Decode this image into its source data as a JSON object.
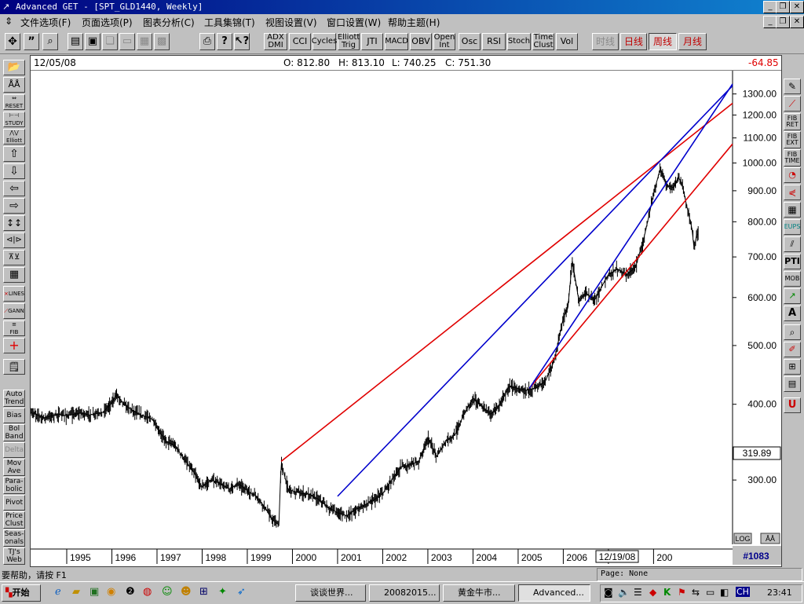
{
  "window": {
    "title": "Advanced GET - [SPT_GLD1440, Weekly]",
    "minimize": "_",
    "restore": "❐",
    "close": "✕"
  },
  "menu": [
    "文件选项(F)",
    "页面选项(P)",
    "图表分析(C)",
    "工具集锦(T)",
    "视图设置(V)",
    "窗口设置(W)",
    "帮助主题(H)"
  ],
  "toolbar": {
    "icons": [
      "cursor-icon",
      "quote-icon",
      "zoom-icon",
      "page-icon",
      "print-preview-icon",
      "copy-icon",
      "paste-icon",
      "edit-icon",
      "grid-icon",
      "printer-icon",
      "help-icon",
      "context-help-icon"
    ],
    "studies": [
      "ADX DMI",
      "CCI",
      "Cycles",
      "Elliott Trig",
      "JTI",
      "MACD",
      "OBV",
      "Open Int",
      "Osc",
      "RSI",
      "Stoch",
      "Time Clust",
      "Vol"
    ],
    "periods": [
      "时线",
      "日线",
      "周线",
      "月线"
    ],
    "active_period": "周线"
  },
  "quote": {
    "date": "12/05/08",
    "open": "O: 812.80",
    "high": "H: 813.10",
    "low": "L: 740.25",
    "close": "C: 751.30",
    "change": "-64.85"
  },
  "left_tools": [
    "Auto Trend",
    "Bias",
    "Bol Band",
    "Delta",
    "Mov Ave",
    "Para-bolic",
    "Pivot",
    "Price Clust",
    "Seas-onals",
    "TJ's Web"
  ],
  "right_tools": [
    "FIB RET",
    "FIB EXT",
    "FIB TIME",
    "EUPS",
    "PTI",
    "MOB",
    "A"
  ],
  "chart_data": {
    "type": "line",
    "scale": "log",
    "ylim": [
      235,
      1420
    ],
    "y_ticks": [
      "1300.00",
      "1200.00",
      "1100.00",
      "1000.00",
      "900.00",
      "800.00",
      "700.00",
      "600.00",
      "500.00",
      "400.00",
      "300.00"
    ],
    "y_tick_values": [
      1300,
      1200,
      1100,
      1000,
      900,
      800,
      700,
      600,
      500,
      400,
      300
    ],
    "x_labels": [
      "1995",
      "1996",
      "1997",
      "1998",
      "1999",
      "2000",
      "2001",
      "2002",
      "2003",
      "2004",
      "2005",
      "2006",
      "2007",
      "200"
    ],
    "x_label_values": [
      1995,
      1996,
      1997,
      1998,
      1999,
      2000,
      2001,
      2002,
      2003,
      2004,
      2005,
      2006,
      2007,
      2008
    ],
    "xlim": [
      1994.2,
      2009.75
    ],
    "current_price": "319.89",
    "date_marker": "12/19/08",
    "log_label": "LOG",
    "bar_count": "#1083",
    "series": [
      {
        "points": [
          [
            1994.2,
            388
          ],
          [
            1994.5,
            380
          ],
          [
            1994.8,
            385
          ],
          [
            1995.0,
            383
          ],
          [
            1995.3,
            387
          ],
          [
            1995.5,
            384
          ],
          [
            1995.8,
            388
          ],
          [
            1996.0,
            402
          ],
          [
            1996.1,
            415
          ],
          [
            1996.3,
            398
          ],
          [
            1996.6,
            385
          ],
          [
            1996.9,
            378
          ],
          [
            1997.0,
            365
          ],
          [
            1997.2,
            348
          ],
          [
            1997.4,
            342
          ],
          [
            1997.6,
            325
          ],
          [
            1997.8,
            310
          ],
          [
            1998.0,
            292
          ],
          [
            1998.2,
            300
          ],
          [
            1998.4,
            296
          ],
          [
            1998.6,
            290
          ],
          [
            1998.8,
            296
          ],
          [
            1999.0,
            288
          ],
          [
            1999.2,
            282
          ],
          [
            1999.4,
            270
          ],
          [
            1999.55,
            258
          ],
          [
            1999.7,
            253
          ],
          [
            1999.75,
            322
          ],
          [
            1999.8,
            310
          ],
          [
            1999.9,
            290
          ],
          [
            2000.0,
            288
          ],
          [
            2000.2,
            285
          ],
          [
            2000.4,
            284
          ],
          [
            2000.6,
            278
          ],
          [
            2000.8,
            270
          ],
          [
            2001.0,
            265
          ],
          [
            2001.2,
            262
          ],
          [
            2001.4,
            268
          ],
          [
            2001.6,
            273
          ],
          [
            2001.8,
            278
          ],
          [
            2002.0,
            285
          ],
          [
            2002.2,
            300
          ],
          [
            2002.4,
            315
          ],
          [
            2002.6,
            318
          ],
          [
            2002.8,
            322
          ],
          [
            2003.0,
            352
          ],
          [
            2003.2,
            328
          ],
          [
            2003.4,
            348
          ],
          [
            2003.6,
            356
          ],
          [
            2003.8,
            385
          ],
          [
            2004.0,
            410
          ],
          [
            2004.2,
            396
          ],
          [
            2004.4,
            385
          ],
          [
            2004.6,
            400
          ],
          [
            2004.8,
            428
          ],
          [
            2005.0,
            425
          ],
          [
            2005.2,
            422
          ],
          [
            2005.4,
            426
          ],
          [
            2005.6,
            436
          ],
          [
            2005.8,
            472
          ],
          [
            2006.0,
            555
          ],
          [
            2006.1,
            575
          ],
          [
            2006.2,
            690
          ],
          [
            2006.35,
            590
          ],
          [
            2006.5,
            610
          ],
          [
            2006.7,
            595
          ],
          [
            2006.9,
            635
          ],
          [
            2007.0,
            655
          ],
          [
            2007.2,
            668
          ],
          [
            2007.4,
            655
          ],
          [
            2007.6,
            672
          ],
          [
            2007.8,
            760
          ],
          [
            2007.9,
            820
          ],
          [
            2008.0,
            890
          ],
          [
            2008.15,
            980
          ],
          [
            2008.3,
            920
          ],
          [
            2008.45,
            910
          ],
          [
            2008.55,
            950
          ],
          [
            2008.65,
            910
          ],
          [
            2008.75,
            840
          ],
          [
            2008.85,
            780
          ],
          [
            2008.9,
            720
          ],
          [
            2008.95,
            760
          ],
          [
            2009.0,
            765
          ]
        ]
      }
    ]
  },
  "trendlines": [
    {
      "color": "#e00000",
      "p1": [
        1999.75,
        322
      ],
      "p2": [
        2008.17,
        1012
      ]
    },
    {
      "color": "#e00000",
      "p1": [
        2005.25,
        425
      ],
      "p2": [
        2009.75,
        1075
      ]
    },
    {
      "color": "#0000cc",
      "p1": [
        2001.0,
        282
      ],
      "p2": [
        2008.17,
        1012
      ]
    },
    {
      "color": "#0000cc",
      "p1": [
        2005.25,
        425
      ],
      "p2": [
        2009.75,
        1350
      ]
    }
  ],
  "status": {
    "help": "要帮助，请按 F1",
    "page": "Page: None"
  },
  "taskbar": {
    "start": "开始",
    "tasks": [
      "谈谈世界...",
      "20082015...",
      "黄金牛市...",
      "Advanced..."
    ],
    "ime": "CH",
    "time": "23:41"
  }
}
